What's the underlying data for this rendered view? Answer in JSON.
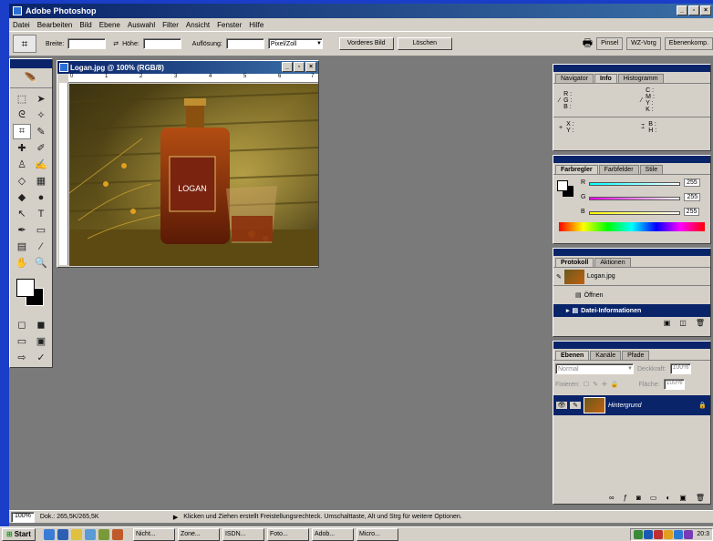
{
  "app": {
    "title": "Adobe Photoshop"
  },
  "menu": [
    "Datei",
    "Bearbeiten",
    "Bild",
    "Ebene",
    "Auswahl",
    "Filter",
    "Ansicht",
    "Fenster",
    "Hilfe"
  ],
  "options": {
    "breite_label": "Breite:",
    "hoehe_label": "Höhe:",
    "aufloesung_label": "Auflösung:",
    "unit": "Pixel/Zoll",
    "front_image_btn": "Vorderes Bild",
    "clear_btn": "Löschen",
    "palette_tabs": [
      "Pinsel",
      "WZ-Vorg",
      "Ebenenkomp."
    ]
  },
  "document": {
    "title": "Logan.jpg @ 100% (RGB/8)",
    "bottle_label": "LOGAN",
    "ruler_marks": [
      "0",
      "1",
      "2",
      "3",
      "4",
      "5",
      "6",
      "7"
    ]
  },
  "nav_panel": {
    "tabs": [
      "Navigator",
      "Info",
      "Histogramm"
    ],
    "rgb": [
      "R :",
      "G :",
      "B :"
    ],
    "cmyk": [
      "C :",
      "M :",
      "Y :",
      "K :"
    ],
    "xy": [
      "X :",
      "Y :"
    ],
    "bh": [
      "B :",
      "H :"
    ]
  },
  "color_panel": {
    "tabs": [
      "Farbregler",
      "Farbfelder",
      "Stile"
    ],
    "labels": [
      "R",
      "G",
      "B"
    ],
    "values": [
      "255",
      "255",
      "255"
    ]
  },
  "history_panel": {
    "tabs": [
      "Protokoll",
      "Aktionen"
    ],
    "snapshot": "Logan.jpg",
    "items": [
      "Öffnen",
      "Datei-Informationen"
    ]
  },
  "layers_panel": {
    "tabs": [
      "Ebenen",
      "Kanäle",
      "Pfade"
    ],
    "blend": "Normal",
    "opacity_label": "Deckkraft:",
    "opacity": "100%",
    "lock_label": "Fixieren:",
    "fill_label": "Fläche:",
    "fill": "100%",
    "layer_name": "Hintergrund"
  },
  "status": {
    "zoom": "100%",
    "doc": "Dok.: 265,5K/265,5K",
    "hint": "Klicken und Ziehen erstellt Freistellungsrechteck. Umschalttaste, Alt und Strg für weitere Optionen."
  },
  "taskbar": {
    "start": "Start",
    "items": [
      "Nicht...",
      "Zone...",
      "ISDN...",
      "Foto...",
      "Adob...",
      "Micro..."
    ],
    "clock": "20:3"
  }
}
